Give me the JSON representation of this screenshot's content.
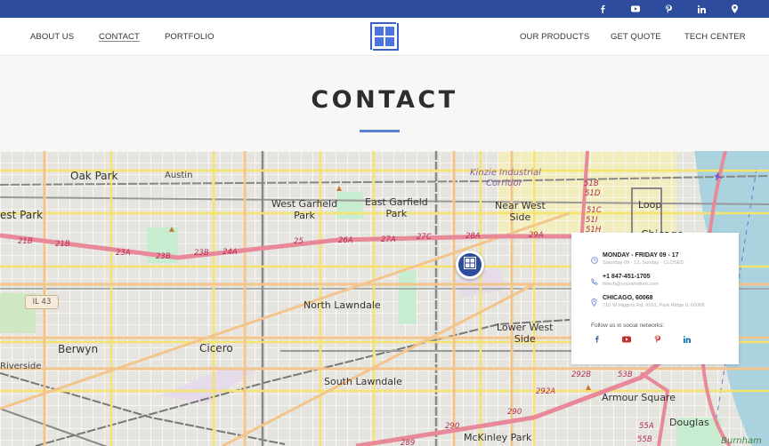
{
  "topbar": {
    "background": "#2e4c9e",
    "social": [
      {
        "name": "facebook",
        "icon": "facebook-icon"
      },
      {
        "name": "youtube",
        "icon": "youtube-icon"
      },
      {
        "name": "pinterest",
        "icon": "pinterest-icon"
      },
      {
        "name": "linkedin",
        "icon": "linkedin-icon"
      },
      {
        "name": "location",
        "icon": "location-pin-icon"
      }
    ]
  },
  "nav": {
    "left": [
      {
        "label": "ABOUT US",
        "active": false
      },
      {
        "label": "CONTACT",
        "active": true
      },
      {
        "label": "PORTFOLIO",
        "active": false
      }
    ],
    "right": [
      {
        "label": "OUR PRODUCTS",
        "active": false
      },
      {
        "label": "GET QUOTE",
        "active": false
      },
      {
        "label": "TECH CENTER",
        "active": false
      }
    ],
    "logo": "window-logo-icon"
  },
  "hero": {
    "title": "CONTACT",
    "accent": "#5b7fd1"
  },
  "map": {
    "places": {
      "oak_park": "Oak Park",
      "austin": "Austin",
      "forest_park": "est Park",
      "west_garfield_1": "West Garfield",
      "west_garfield_2": "Park",
      "east_garfield_1": "East Garfield",
      "east_garfield_2": "Park",
      "near_west_1": "Near West",
      "near_west_2": "Side",
      "loop": "Loop",
      "chicago": "Chicago",
      "north_lawndale": "North Lawndale",
      "berwyn": "Berwyn",
      "riverside_1": "Riverside",
      "riverside_2": "rside",
      "cicero": "Cicero",
      "south_lawndale": "South Lawndale",
      "lower_west_1": "Lower West",
      "lower_west_2": "Side",
      "armour_square": "Armour Square",
      "douglas": "Douglas",
      "mckinley_park": "McKinley Park",
      "burnham": "Burnham",
      "kinzie_1": "Kinzie Industrial",
      "kinzie_2": "Corridor"
    },
    "route_shield": "IL 43",
    "exits": [
      "21B",
      "21B",
      "23A",
      "23B",
      "23B",
      "24A",
      "25",
      "26A",
      "27A",
      "27C",
      "28A",
      "29A",
      "51B",
      "51D",
      "51C",
      "51I",
      "51H",
      "292A",
      "292B",
      "290",
      "290",
      "289",
      "53B",
      "55A",
      "55B"
    ]
  },
  "contact_card": {
    "hours_title": "MONDAY - FRIDAY 09 - 17",
    "hours_sub": "Saturday 09 - 13, Sunday - CLOSED",
    "phone": "+1 847-451-1705",
    "email": "hitech@yourwindoor.com",
    "city": "CHICAGO, 60068",
    "address": "710 W Higgins Rd, #101, Park Ridge IL 60068",
    "follow_label": "Follow us in social networks:",
    "social": [
      {
        "name": "facebook",
        "color": "#3b5998"
      },
      {
        "name": "youtube",
        "color": "#c4302b"
      },
      {
        "name": "pinterest",
        "color": "#cb2027"
      },
      {
        "name": "linkedin",
        "color": "#0e76a8"
      }
    ]
  }
}
